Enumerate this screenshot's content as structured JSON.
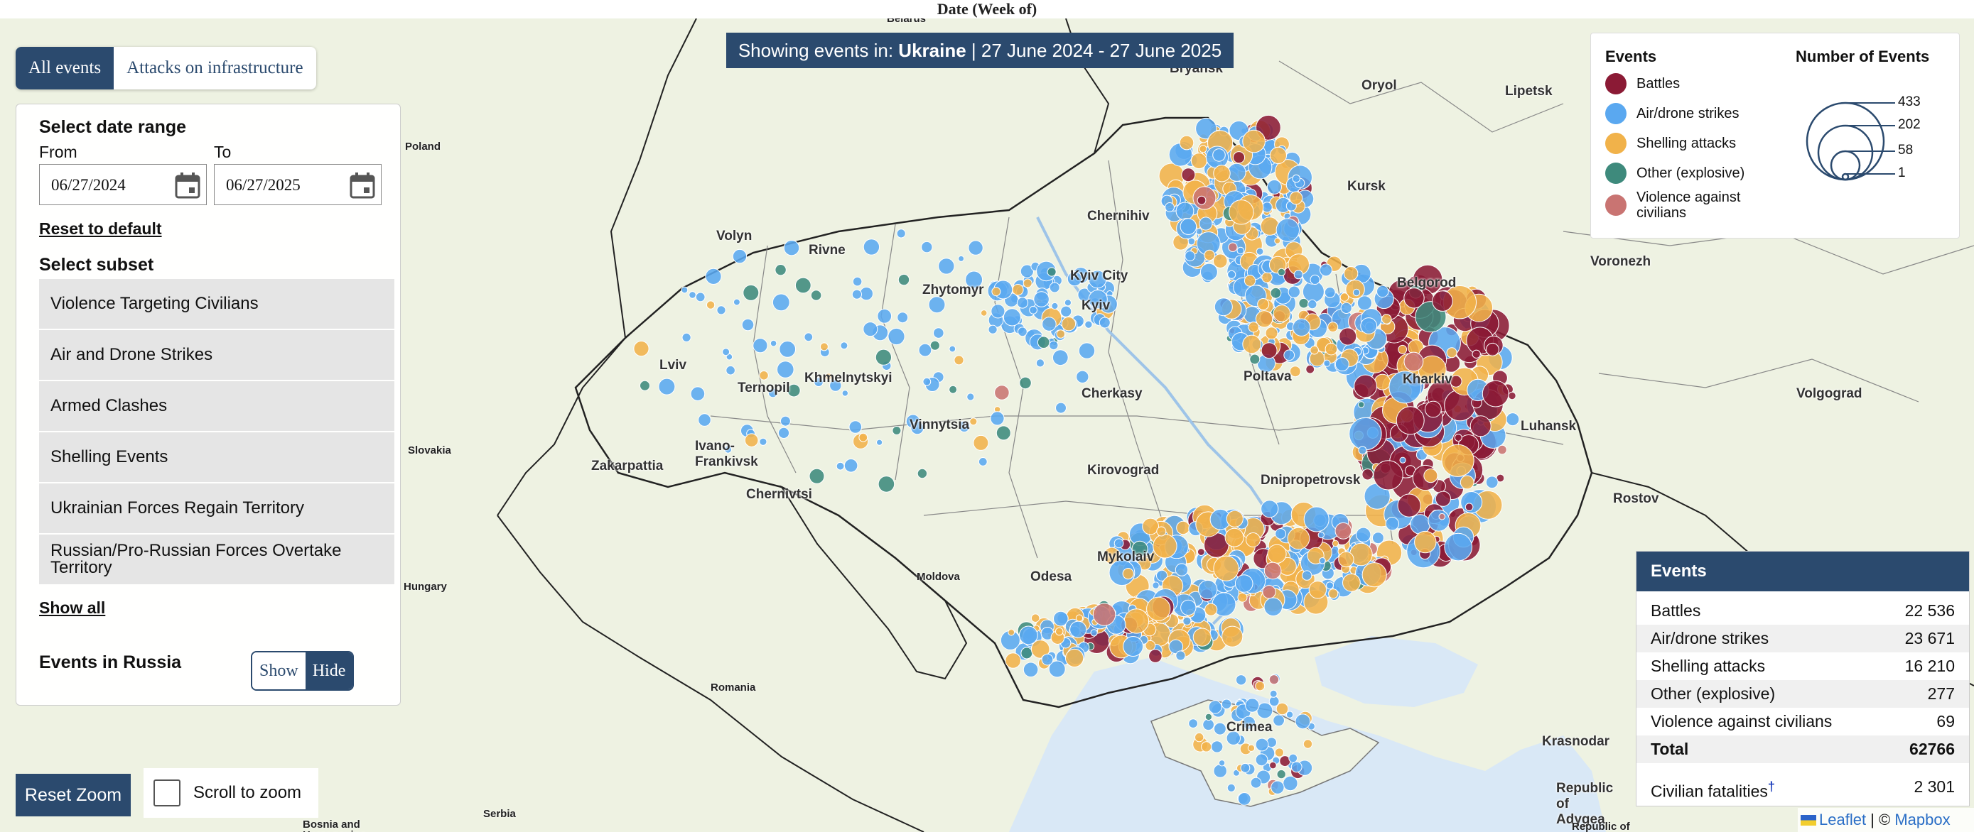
{
  "top_caption": "Date (Week of)",
  "layer_tabs": [
    "All events",
    "Attacks on infrastructure"
  ],
  "banner": {
    "prefix": "Showing events in:",
    "country": "Ukraine",
    "range": "| 27 June 2024 - 27 June 2025"
  },
  "filter": {
    "date_heading": "Select date range",
    "from_label": "From",
    "to_label": "To",
    "from_value": "06/27/2024",
    "to_value": "06/27/2025",
    "reset_label": "Reset to default",
    "subset_heading": "Select subset",
    "subsets": [
      "Violence Targeting Civilians",
      "Air and Drone Strikes",
      "Armed Clashes",
      "Shelling Events",
      "Ukrainian Forces Regain Territory",
      "Russian/Pro-Russian Forces Overtake Territory"
    ],
    "show_all": "Show all",
    "russia_label": "Events in Russia",
    "russia_options": [
      "Show",
      "Hide"
    ]
  },
  "legend": {
    "events_heading": "Events",
    "size_heading": "Number of Events",
    "items": [
      {
        "label": "Battles",
        "color": "#8b1a35"
      },
      {
        "label": "Air/drone strikes",
        "color": "#5aa8f0"
      },
      {
        "label": "Shelling attacks",
        "color": "#f1b24a"
      },
      {
        "label": "Other (explosive)",
        "color": "#3e8a7c"
      },
      {
        "label": "Violence against civilians",
        "color": "#c97472"
      }
    ],
    "size_values": [
      "433",
      "202",
      "58",
      "1"
    ]
  },
  "events_table": {
    "header": "Events",
    "rows": [
      {
        "label": "Battles",
        "value": "22 536"
      },
      {
        "label": "Air/drone strikes",
        "value": "23 671"
      },
      {
        "label": "Shelling attacks",
        "value": "16 210"
      },
      {
        "label": "Other (explosive)",
        "value": "277"
      },
      {
        "label": "Violence against civilians",
        "value": "69"
      }
    ],
    "total_label": "Total",
    "total_value": "62766",
    "fatalities_label": "Civilian fatalities",
    "fatalities_mark": "†",
    "fatalities_value": "2 301"
  },
  "controls": {
    "reset_zoom": "Reset Zoom",
    "scroll_zoom": "Scroll to zoom"
  },
  "attribution": {
    "leaflet": "Leaflet",
    "sep": " | © ",
    "mapbox": "Mapbox"
  },
  "map": {
    "cities": [
      "Bryansk",
      "Oryol",
      "Lipetsk",
      "Kursk",
      "Chernihiv",
      "Volyn",
      "Rivne",
      "Zhytomyr",
      "Kyiv City",
      "Kyiv",
      "Voronezh",
      "Belgorod",
      "Lviv",
      "Ternopil",
      "Khmelnytskyi",
      "Cherkasy",
      "Poltava",
      "Vinnytsia",
      "Ivano-Frankivsk",
      "Zakarpattia",
      "Chernivtsi",
      "Kirovograd",
      "Dnipropetrovsk",
      "Luhansk",
      "Volgograd",
      "Rostov",
      "Mykolaiv",
      "Odesa",
      "Crimea",
      "Krasnodar",
      "Republic of Adygea",
      "Kharkiv"
    ],
    "countries": [
      "Belarus",
      "Poland",
      "Slovakia",
      "Hungary",
      "Moldova",
      "Romania",
      "Serbia",
      "Bosnia and Herzegovina",
      "Republic of"
    ]
  }
}
